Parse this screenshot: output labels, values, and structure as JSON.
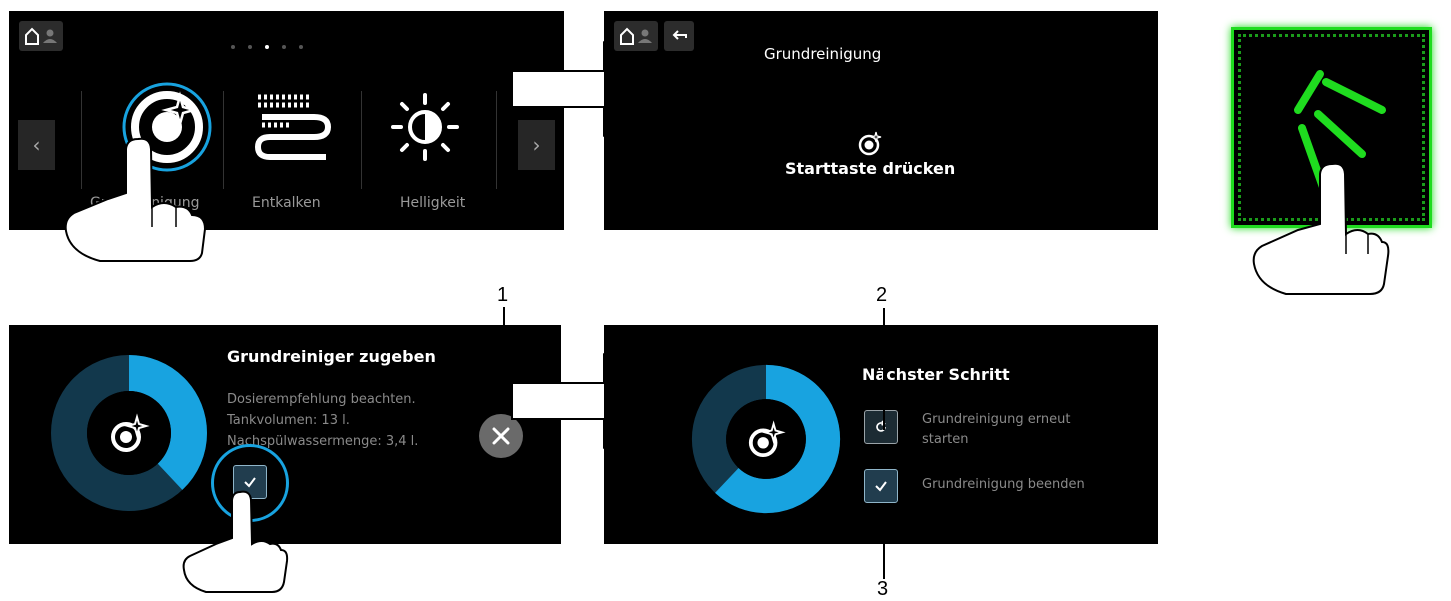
{
  "panel1": {
    "menu_items": [
      {
        "label": "Grundreinigung",
        "icon": "cleaning-icon"
      },
      {
        "label": "Entkalken",
        "icon": "descale-icon"
      },
      {
        "label": "Helligkeit",
        "icon": "brightness-icon"
      }
    ],
    "pager": {
      "count": 5,
      "active_index": 2
    }
  },
  "panel2": {
    "title": "Grundreinigung",
    "instruction": "Starttaste drücken",
    "colors": {
      "start_button": "#1fdc1f"
    }
  },
  "panel3": {
    "heading": "Grundreiniger zugeben",
    "lines": [
      "Dosierempfehlung beachten.",
      "Tankvolumen: 13 l.",
      "Nachspülwassermenge: 3,4 l."
    ],
    "progress_fraction": 0.38
  },
  "panel4": {
    "heading": "Nächster Schritt",
    "options": [
      {
        "label_line1": "Grundreinigung erneut",
        "label_line2": "starten",
        "icon": "restart-icon"
      },
      {
        "label_line1": "Grundreinigung beenden",
        "label_line2": "",
        "icon": "check-icon"
      }
    ],
    "progress_fraction": 0.62
  },
  "callouts": [
    "1",
    "2",
    "3"
  ],
  "colors": {
    "accent_blue": "#18a3e0",
    "dark_blue": "#12384c",
    "panel_bg": "#000000"
  }
}
